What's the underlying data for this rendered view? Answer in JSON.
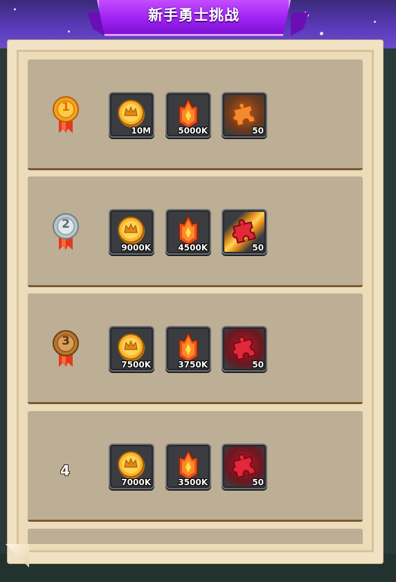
{
  "header": {
    "title": "新手勇士挑战"
  },
  "colors": {
    "banner": "#9b1ff0",
    "row": "#bdae96",
    "parchment": "#f1e2c3",
    "gold_medal": "#f6a21a",
    "silver_medal": "#b9c6c9",
    "bronze_medal": "#b8762e"
  },
  "ranks": [
    {
      "rank": "1",
      "medal": "gold-medal-icon",
      "rewards": [
        {
          "icon": "gold-coin-icon",
          "amount": "10M"
        },
        {
          "icon": "fire-crystal-icon",
          "amount": "5000K"
        },
        {
          "icon": "orange-puzzle-piece-icon",
          "amount": "50"
        }
      ]
    },
    {
      "rank": "2",
      "medal": "silver-medal-icon",
      "rewards": [
        {
          "icon": "gold-coin-icon",
          "amount": "9000K"
        },
        {
          "icon": "fire-crystal-icon",
          "amount": "4500K"
        },
        {
          "icon": "red-puzzle-piece-icon",
          "amount": "50"
        }
      ]
    },
    {
      "rank": "3",
      "medal": "bronze-medal-icon",
      "rewards": [
        {
          "icon": "gold-coin-icon",
          "amount": "7500K"
        },
        {
          "icon": "fire-crystal-icon",
          "amount": "3750K"
        },
        {
          "icon": "red-puzzle-piece-icon",
          "amount": "50"
        }
      ]
    },
    {
      "rank": "4",
      "medal": "",
      "rewards": [
        {
          "icon": "gold-coin-icon",
          "amount": "7000K"
        },
        {
          "icon": "fire-crystal-icon",
          "amount": "3500K"
        },
        {
          "icon": "red-puzzle-piece-icon",
          "amount": "50"
        }
      ]
    }
  ]
}
